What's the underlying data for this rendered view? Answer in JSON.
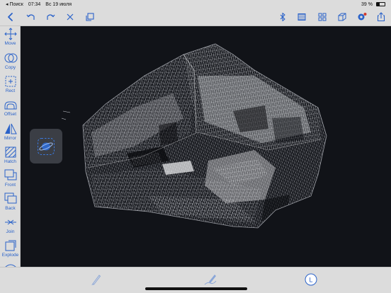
{
  "status": {
    "carrier": "◂ Поиск",
    "time": "07:34",
    "date": "Вс 19 июля",
    "battery": "39 %"
  },
  "toolbar": {
    "left_icons": [
      "back-icon",
      "undo-icon",
      "redo-icon",
      "close-icon",
      "copy-icon"
    ],
    "right_icons": [
      "bluetooth-icon",
      "layers-icon",
      "grid-icon",
      "cube-icon",
      "settings-icon",
      "share-icon"
    ]
  },
  "sidebar": {
    "tools": [
      {
        "label": "Move",
        "icon": "move-icon"
      },
      {
        "label": "Copy",
        "icon": "copy-circles-icon"
      },
      {
        "label": "Rect",
        "icon": "rect-icon"
      },
      {
        "label": "Offset",
        "icon": "offset-icon"
      },
      {
        "label": "Mirror",
        "icon": "mirror-icon"
      },
      {
        "label": "Hatch",
        "icon": "hatch-icon"
      },
      {
        "label": "Front",
        "icon": "front-icon"
      },
      {
        "label": "Back",
        "icon": "back-order-icon"
      },
      {
        "label": "Join",
        "icon": "join-icon"
      },
      {
        "label": "Explode",
        "icon": "explode-icon"
      }
    ]
  },
  "floating": {
    "icon": "orbit-3d-icon"
  },
  "bottom": {
    "icons": [
      "pencil-icon",
      "draw-pencil-icon",
      "layer-L-icon"
    ],
    "layer_letter": "L"
  },
  "colors": {
    "accent": "#2a62c9",
    "toolbar": "#dcdcdc",
    "canvas": "#111318"
  }
}
